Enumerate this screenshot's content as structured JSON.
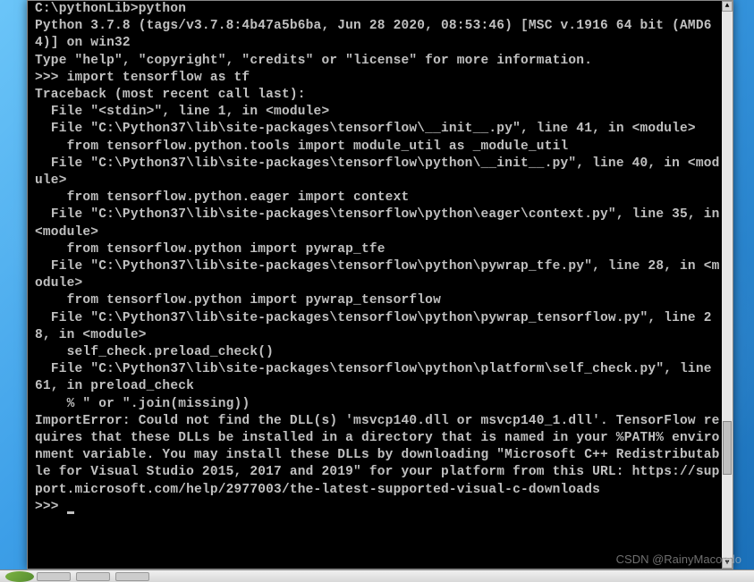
{
  "watermark": "CSDN @RainyMacondo",
  "terminal": {
    "lines": [
      "",
      "C:\\pythonLib>python",
      "Python 3.7.8 (tags/v3.7.8:4b47a5b6ba, Jun 28 2020, 08:53:46) [MSC v.1916 64 bit (AMD64)] on win32",
      "Type \"help\", \"copyright\", \"credits\" or \"license\" for more information.",
      ">>> import tensorflow as tf",
      "Traceback (most recent call last):",
      "  File \"<stdin>\", line 1, in <module>",
      "  File \"C:\\Python37\\lib\\site-packages\\tensorflow\\__init__.py\", line 41, in <module>",
      "    from tensorflow.python.tools import module_util as _module_util",
      "  File \"C:\\Python37\\lib\\site-packages\\tensorflow\\python\\__init__.py\", line 40, in <module>",
      "    from tensorflow.python.eager import context",
      "  File \"C:\\Python37\\lib\\site-packages\\tensorflow\\python\\eager\\context.py\", line 35, in <module>",
      "    from tensorflow.python import pywrap_tfe",
      "  File \"C:\\Python37\\lib\\site-packages\\tensorflow\\python\\pywrap_tfe.py\", line 28, in <module>",
      "    from tensorflow.python import pywrap_tensorflow",
      "  File \"C:\\Python37\\lib\\site-packages\\tensorflow\\python\\pywrap_tensorflow.py\", line 28, in <module>",
      "    self_check.preload_check()",
      "  File \"C:\\Python37\\lib\\site-packages\\tensorflow\\python\\platform\\self_check.py\", line 61, in preload_check",
      "    % \" or \".join(missing))",
      "ImportError: Could not find the DLL(s) 'msvcp140.dll or msvcp140_1.dll'. TensorFlow requires that these DLLs be installed in a directory that is named in your %PATH% environment variable. You may install these DLLs by downloading \"Microsoft C++ Redistributable for Visual Studio 2015, 2017 and 2019\" for your platform from this URL: https://support.microsoft.com/help/2977003/the-latest-supported-visual-c-downloads",
      ">>> "
    ]
  },
  "scrollbar": {
    "up_arrow": "▲",
    "down_arrow": "▼"
  }
}
